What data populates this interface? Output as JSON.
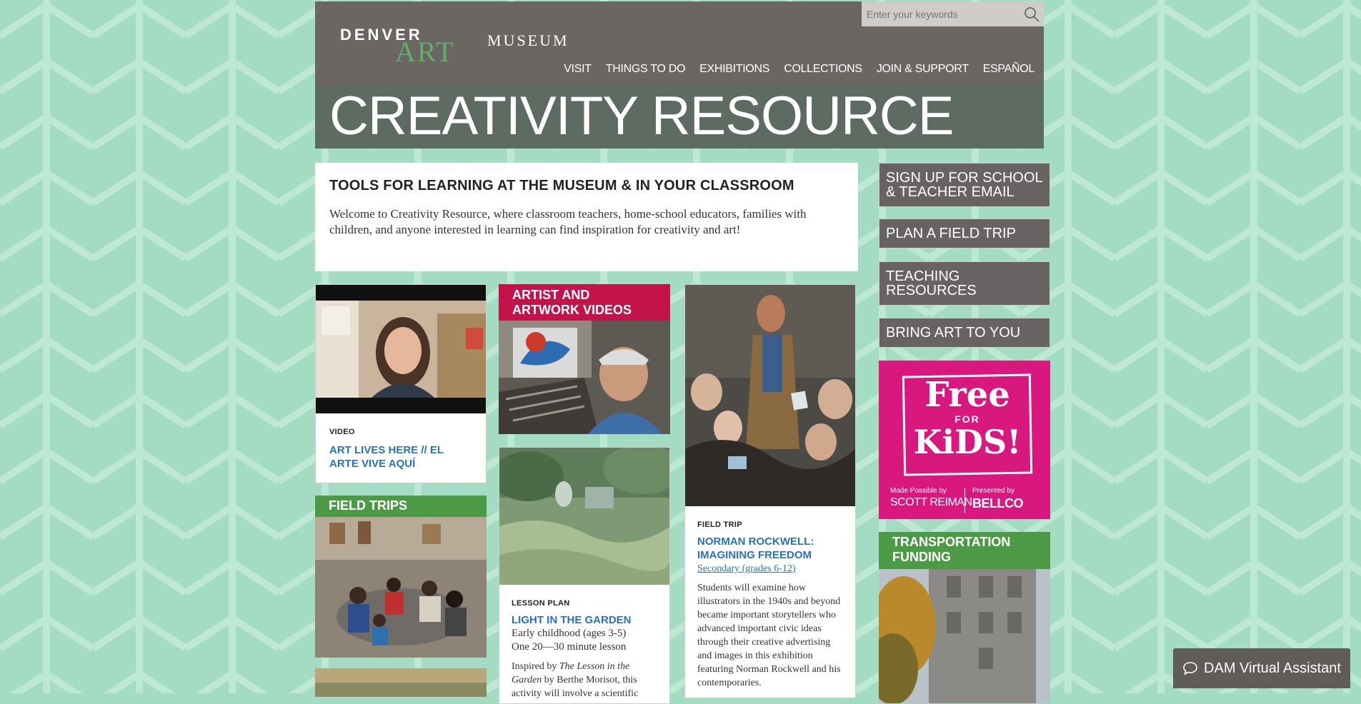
{
  "logo": {
    "denver": "DENVER",
    "art": "ART",
    "museum": "MUSEUM"
  },
  "search": {
    "placeholder": "Enter your keywords"
  },
  "nav": [
    "VISIT",
    "THINGS TO DO",
    "EXHIBITIONS",
    "COLLECTIONS",
    "JOIN & SUPPORT",
    "ESPAÑOL"
  ],
  "hero": {
    "title": "CREATIVITY RESOURCE"
  },
  "intro": {
    "heading": "TOOLS FOR LEARNING AT THE MUSEUM & IN YOUR CLASSROOM",
    "text": "Welcome to Creativity Resource, where classroom teachers, home-school educators, families with children, and anyone interested in learning can find inspiration for creativity and art!"
  },
  "cards": {
    "video": {
      "tag": "VIDEO",
      "title": "ART LIVES HERE // EL ARTE VIVE AQUÍ"
    },
    "field_trips": {
      "banner": "FIELD TRIPS"
    },
    "artist_videos": {
      "banner": "ARTIST AND ARTWORK VIDEOS"
    },
    "lesson": {
      "tag": "LESSON PLAN",
      "title": "LIGHT IN THE GARDEN",
      "meta1": "Early childhood (ages 3-5)",
      "meta2": "One 20—30 minute lesson",
      "body_prefix": "Inspired by ",
      "body_italic": "The Lesson in the Garden",
      "body_suffix": " by Berthe Morisot, this activity will involve a scientific"
    },
    "rockwell": {
      "tag": "FIELD TRIP",
      "title": "NORMAN ROCKWELL: IMAGINING FREEDOM",
      "link": "Secondary (grades 6-12)",
      "body": "Students will examine how illustrators in the 1940s and beyond became important storytellers who advanced important civic ideas through their creative advertising and images in this exhibition featuring Norman Rockwell and his contemporaries."
    }
  },
  "sidebar": {
    "items": [
      "SIGN UP FOR SCHOOL & TEACHER EMAIL",
      "PLAN A FIELD TRIP",
      "TEACHING RESOURCES",
      "BRING ART TO YOU"
    ],
    "promo": {
      "free": "Free",
      "for": "FOR",
      "kids": "KiDS!",
      "made_by_label": "Made Possible by",
      "made_by": "SCOTT REIMAN",
      "presented_label": "Presented by",
      "presented": "BELLCO"
    },
    "transport": "TRANSPORTATION FUNDING"
  },
  "assistant": {
    "label": "DAM Virtual Assistant"
  },
  "colors": {
    "header": "#6b6661",
    "green": "#4c9a46",
    "crimson": "#c2144a",
    "link": "#2a72b5",
    "promo": "#d8177f",
    "background": "#a3dcc3"
  }
}
